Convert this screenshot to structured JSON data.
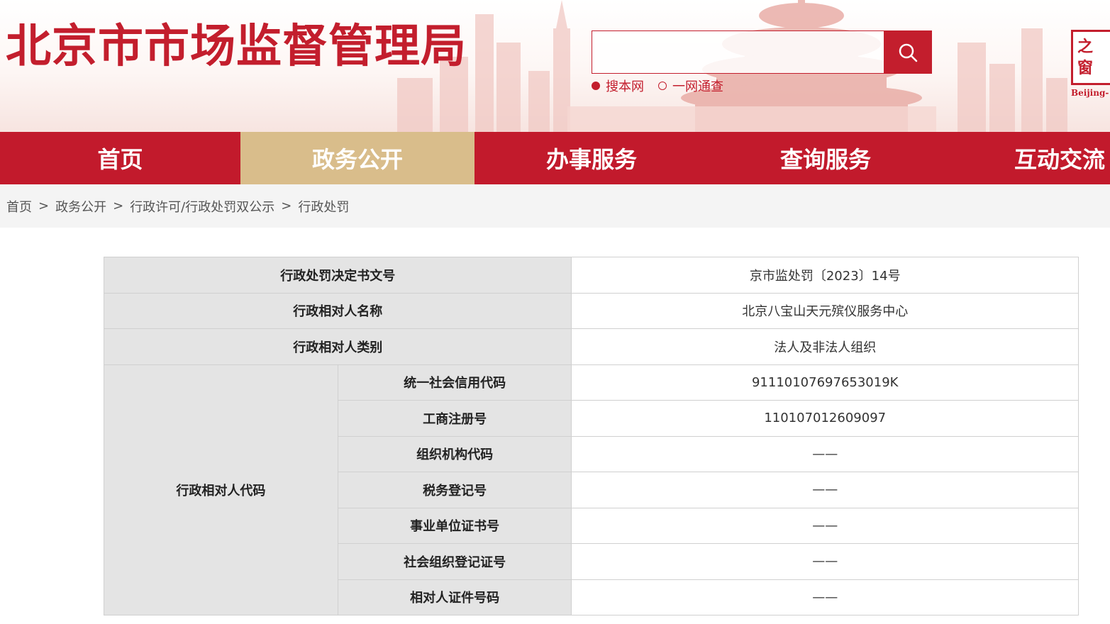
{
  "header": {
    "site_title": "北京市市场监督管理局",
    "search": {
      "placeholder": "",
      "button_icon": "search-icon",
      "scope_options": [
        {
          "label": "搜本网",
          "selected": true
        },
        {
          "label": "一网通查",
          "selected": false
        }
      ]
    },
    "badge": {
      "chars": [
        "之",
        "窗"
      ],
      "caption": "Beijing-"
    }
  },
  "nav": {
    "items": [
      {
        "label": "首页",
        "active": false
      },
      {
        "label": "政务公开",
        "active": true
      },
      {
        "label": "办事服务",
        "active": false
      },
      {
        "label": "查询服务",
        "active": false
      },
      {
        "label": "互动交流",
        "active": false
      }
    ]
  },
  "breadcrumb": {
    "items": [
      "首页",
      "政务公开",
      "行政许可/行政处罚双公示",
      "行政处罚"
    ],
    "separator": ">"
  },
  "detail": {
    "rows": [
      {
        "label": "行政处罚决定书文号",
        "value": "京市监处罚〔2023〕14号"
      },
      {
        "label": "行政相对人名称",
        "value": "北京八宝山天元殡仪服务中心"
      },
      {
        "label": "行政相对人类别",
        "value": "法人及非法人组织"
      }
    ],
    "code_group": {
      "label": "行政相对人代码",
      "rows": [
        {
          "label": "统一社会信用代码",
          "value": "91110107697653019K"
        },
        {
          "label": "工商注册号",
          "value": "110107012609097"
        },
        {
          "label": "组织机构代码",
          "value": "——"
        },
        {
          "label": "税务登记号",
          "value": "——"
        },
        {
          "label": "事业单位证书号",
          "value": "——"
        },
        {
          "label": "社会组织登记证号",
          "value": "——"
        },
        {
          "label": "相对人证件号码",
          "value": "——"
        }
      ]
    }
  },
  "colors": {
    "brand_red": "#c21a2c",
    "nav_active": "#d9bd8b",
    "label_bg": "#e4e4e4"
  }
}
